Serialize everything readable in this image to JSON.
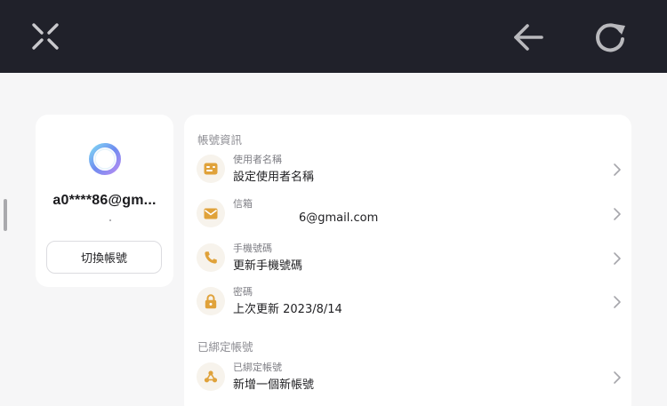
{
  "colors": {
    "topbar_bg": "#20212a",
    "page_bg": "#f6f6f7",
    "card_bg": "#ffffff",
    "accent_orange": "#e0a23a",
    "icon_circle_bg": "#f7f3ec"
  },
  "topbar": {
    "close_icon": "close-x-icon",
    "back_icon": "arrow-left-icon",
    "refresh_icon": "refresh-icon"
  },
  "profile": {
    "email_masked": "a0****86@gm...",
    "switch_account_label": "切換帳號"
  },
  "account_info": {
    "section_title": "帳號資訊",
    "rows": [
      {
        "icon": "id-card-icon",
        "label": "使用者名稱",
        "value": "設定使用者名稱"
      },
      {
        "icon": "mail-icon",
        "label": "信箱",
        "value": "6@gmail.com"
      },
      {
        "icon": "phone-icon",
        "label": "手機號碼",
        "value": "更新手機號碼"
      },
      {
        "icon": "lock-icon",
        "label": "密碼",
        "value": "上次更新 2023/8/14"
      }
    ]
  },
  "linked_accounts": {
    "section_title": "已綁定帳號",
    "rows": [
      {
        "icon": "link-nodes-icon",
        "label": "已綁定帳號",
        "value": "新增一個新帳號"
      }
    ]
  }
}
